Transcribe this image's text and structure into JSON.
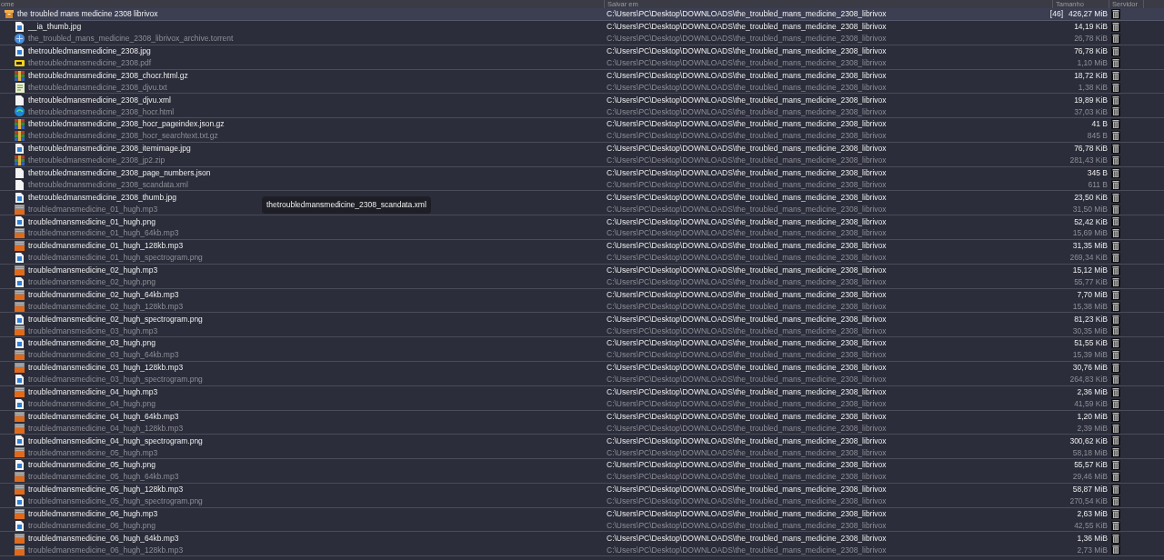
{
  "columns": [
    "ome",
    "Salvar em",
    "Tamanho",
    "Servidor"
  ],
  "group": {
    "name": "the troubled mans medicine 2308 librivox",
    "path": "C:\\Users\\PC\\Desktop\\DOWNLOADS\\the_troubled_mans_medicine_2308_librivox",
    "count": "[46]",
    "size": "426,27 MiB"
  },
  "files": [
    {
      "kind": "image",
      "name": "__ia_thumb.jpg",
      "path": "C:\\Users\\PC\\Desktop\\DOWNLOADS\\the_troubled_mans_medicine_2308_librivox",
      "size": "14,19 KiB"
    },
    {
      "kind": "torrent",
      "name": "the_troubled_mans_medicine_2308_librivox_archive.torrent",
      "path": "C:\\Users\\PC\\Desktop\\DOWNLOADS\\the_troubled_mans_medicine_2308_librivox",
      "size": "26,78 KiB"
    },
    {
      "kind": "image",
      "name": "thetroubledmansmedicine_2308.jpg",
      "path": "C:\\Users\\PC\\Desktop\\DOWNLOADS\\the_troubled_mans_medicine_2308_librivox",
      "size": "76,78 KiB"
    },
    {
      "kind": "pdf",
      "name": "thetroubledmansmedicine_2308.pdf",
      "path": "C:\\Users\\PC\\Desktop\\DOWNLOADS\\the_troubled_mans_medicine_2308_librivox",
      "size": "1,10 MiB"
    },
    {
      "kind": "archive",
      "name": "thetroubledmansmedicine_2308_chocr.html.gz",
      "path": "C:\\Users\\PC\\Desktop\\DOWNLOADS\\the_troubled_mans_medicine_2308_librivox",
      "size": "18,72 KiB"
    },
    {
      "kind": "text",
      "name": "thetroubledmansmedicine_2308_djvu.txt",
      "path": "C:\\Users\\PC\\Desktop\\DOWNLOADS\\the_troubled_mans_medicine_2308_librivox",
      "size": "1,38 KiB"
    },
    {
      "kind": "file",
      "name": "thetroubledmansmedicine_2308_djvu.xml",
      "path": "C:\\Users\\PC\\Desktop\\DOWNLOADS\\the_troubled_mans_medicine_2308_librivox",
      "size": "19,89 KiB"
    },
    {
      "kind": "web",
      "name": "thetroubledmansmedicine_2308_hocr.html",
      "path": "C:\\Users\\PC\\Desktop\\DOWNLOADS\\the_troubled_mans_medicine_2308_librivox",
      "size": "37,03 KiB"
    },
    {
      "kind": "archive",
      "name": "thetroubledmansmedicine_2308_hocr_pageindex.json.gz",
      "path": "C:\\Users\\PC\\Desktop\\DOWNLOADS\\the_troubled_mans_medicine_2308_librivox",
      "size": "41 B"
    },
    {
      "kind": "archive",
      "name": "thetroubledmansmedicine_2308_hocr_searchtext.txt.gz",
      "path": "C:\\Users\\PC\\Desktop\\DOWNLOADS\\the_troubled_mans_medicine_2308_librivox",
      "size": "845 B"
    },
    {
      "kind": "image",
      "name": "thetroubledmansmedicine_2308_itemimage.jpg",
      "path": "C:\\Users\\PC\\Desktop\\DOWNLOADS\\the_troubled_mans_medicine_2308_librivox",
      "size": "76,78 KiB"
    },
    {
      "kind": "archive",
      "name": "thetroubledmansmedicine_2308_jp2.zip",
      "path": "C:\\Users\\PC\\Desktop\\DOWNLOADS\\the_troubled_mans_medicine_2308_librivox",
      "size": "281,43 KiB"
    },
    {
      "kind": "file",
      "name": "thetroubledmansmedicine_2308_page_numbers.json",
      "path": "C:\\Users\\PC\\Desktop\\DOWNLOADS\\the_troubled_mans_medicine_2308_librivox",
      "size": "345 B"
    },
    {
      "kind": "file",
      "name": "thetroubledmansmedicine_2308_scandata.xml",
      "path": "C:\\Users\\PC\\Desktop\\DOWNLOADS\\the_troubled_mans_medicine_2308_librivox",
      "size": "611 B"
    },
    {
      "kind": "image",
      "name": "thetroubledmansmedicine_2308_thumb.jpg",
      "path": "C:\\Users\\PC\\Desktop\\DOWNLOADS\\the_troubled_mans_medicine_2308_librivox",
      "size": "23,50 KiB"
    },
    {
      "kind": "audio",
      "name": "troubledmansmedicine_01_hugh.mp3",
      "path": "C:\\Users\\PC\\Desktop\\DOWNLOADS\\the_troubled_mans_medicine_2308_librivox",
      "size": "31,50 MiB"
    },
    {
      "kind": "image",
      "name": "troubledmansmedicine_01_hugh.png",
      "path": "C:\\Users\\PC\\Desktop\\DOWNLOADS\\the_troubled_mans_medicine_2308_librivox",
      "size": "52,42 KiB"
    },
    {
      "kind": "audio",
      "name": "troubledmansmedicine_01_hugh_64kb.mp3",
      "path": "C:\\Users\\PC\\Desktop\\DOWNLOADS\\the_troubled_mans_medicine_2308_librivox",
      "size": "15,69 MiB"
    },
    {
      "kind": "audio",
      "name": "troubledmansmedicine_01_hugh_128kb.mp3",
      "path": "C:\\Users\\PC\\Desktop\\DOWNLOADS\\the_troubled_mans_medicine_2308_librivox",
      "size": "31,35 MiB"
    },
    {
      "kind": "image",
      "name": "troubledmansmedicine_01_hugh_spectrogram.png",
      "path": "C:\\Users\\PC\\Desktop\\DOWNLOADS\\the_troubled_mans_medicine_2308_librivox",
      "size": "269,34 KiB"
    },
    {
      "kind": "audio",
      "name": "troubledmansmedicine_02_hugh.mp3",
      "path": "C:\\Users\\PC\\Desktop\\DOWNLOADS\\the_troubled_mans_medicine_2308_librivox",
      "size": "15,12 MiB"
    },
    {
      "kind": "image",
      "name": "troubledmansmedicine_02_hugh.png",
      "path": "C:\\Users\\PC\\Desktop\\DOWNLOADS\\the_troubled_mans_medicine_2308_librivox",
      "size": "55,77 KiB"
    },
    {
      "kind": "audio",
      "name": "troubledmansmedicine_02_hugh_64kb.mp3",
      "path": "C:\\Users\\PC\\Desktop\\DOWNLOADS\\the_troubled_mans_medicine_2308_librivox",
      "size": "7,70 MiB"
    },
    {
      "kind": "audio",
      "name": "troubledmansmedicine_02_hugh_128kb.mp3",
      "path": "C:\\Users\\PC\\Desktop\\DOWNLOADS\\the_troubled_mans_medicine_2308_librivox",
      "size": "15,38 MiB"
    },
    {
      "kind": "image",
      "name": "troubledmansmedicine_02_hugh_spectrogram.png",
      "path": "C:\\Users\\PC\\Desktop\\DOWNLOADS\\the_troubled_mans_medicine_2308_librivox",
      "size": "81,23 KiB"
    },
    {
      "kind": "audio",
      "name": "troubledmansmedicine_03_hugh.mp3",
      "path": "C:\\Users\\PC\\Desktop\\DOWNLOADS\\the_troubled_mans_medicine_2308_librivox",
      "size": "30,35 MiB"
    },
    {
      "kind": "image",
      "name": "troubledmansmedicine_03_hugh.png",
      "path": "C:\\Users\\PC\\Desktop\\DOWNLOADS\\the_troubled_mans_medicine_2308_librivox",
      "size": "51,55 KiB"
    },
    {
      "kind": "audio",
      "name": "troubledmansmedicine_03_hugh_64kb.mp3",
      "path": "C:\\Users\\PC\\Desktop\\DOWNLOADS\\the_troubled_mans_medicine_2308_librivox",
      "size": "15,39 MiB"
    },
    {
      "kind": "audio",
      "name": "troubledmansmedicine_03_hugh_128kb.mp3",
      "path": "C:\\Users\\PC\\Desktop\\DOWNLOADS\\the_troubled_mans_medicine_2308_librivox",
      "size": "30,76 MiB"
    },
    {
      "kind": "image",
      "name": "troubledmansmedicine_03_hugh_spectrogram.png",
      "path": "C:\\Users\\PC\\Desktop\\DOWNLOADS\\the_troubled_mans_medicine_2308_librivox",
      "size": "264,83 KiB"
    },
    {
      "kind": "audio",
      "name": "troubledmansmedicine_04_hugh.mp3",
      "path": "C:\\Users\\PC\\Desktop\\DOWNLOADS\\the_troubled_mans_medicine_2308_librivox",
      "size": "2,36 MiB"
    },
    {
      "kind": "image",
      "name": "troubledmansmedicine_04_hugh.png",
      "path": "C:\\Users\\PC\\Desktop\\DOWNLOADS\\the_troubled_mans_medicine_2308_librivox",
      "size": "41,59 KiB"
    },
    {
      "kind": "audio",
      "name": "troubledmansmedicine_04_hugh_64kb.mp3",
      "path": "C:\\Users\\PC\\Desktop\\DOWNLOADS\\the_troubled_mans_medicine_2308_librivox",
      "size": "1,20 MiB"
    },
    {
      "kind": "audio",
      "name": "troubledmansmedicine_04_hugh_128kb.mp3",
      "path": "C:\\Users\\PC\\Desktop\\DOWNLOADS\\the_troubled_mans_medicine_2308_librivox",
      "size": "2,39 MiB"
    },
    {
      "kind": "image",
      "name": "troubledmansmedicine_04_hugh_spectrogram.png",
      "path": "C:\\Users\\PC\\Desktop\\DOWNLOADS\\the_troubled_mans_medicine_2308_librivox",
      "size": "300,62 KiB"
    },
    {
      "kind": "audio",
      "name": "troubledmansmedicine_05_hugh.mp3",
      "path": "C:\\Users\\PC\\Desktop\\DOWNLOADS\\the_troubled_mans_medicine_2308_librivox",
      "size": "58,18 MiB"
    },
    {
      "kind": "image",
      "name": "troubledmansmedicine_05_hugh.png",
      "path": "C:\\Users\\PC\\Desktop\\DOWNLOADS\\the_troubled_mans_medicine_2308_librivox",
      "size": "55,57 KiB"
    },
    {
      "kind": "audio",
      "name": "troubledmansmedicine_05_hugh_64kb.mp3",
      "path": "C:\\Users\\PC\\Desktop\\DOWNLOADS\\the_troubled_mans_medicine_2308_librivox",
      "size": "29,46 MiB"
    },
    {
      "kind": "audio",
      "name": "troubledmansmedicine_05_hugh_128kb.mp3",
      "path": "C:\\Users\\PC\\Desktop\\DOWNLOADS\\the_troubled_mans_medicine_2308_librivox",
      "size": "58,87 MiB"
    },
    {
      "kind": "image",
      "name": "troubledmansmedicine_05_hugh_spectrogram.png",
      "path": "C:\\Users\\PC\\Desktop\\DOWNLOADS\\the_troubled_mans_medicine_2308_librivox",
      "size": "270,54 KiB"
    },
    {
      "kind": "audio",
      "name": "troubledmansmedicine_06_hugh.mp3",
      "path": "C:\\Users\\PC\\Desktop\\DOWNLOADS\\the_troubled_mans_medicine_2308_librivox",
      "size": "2,63 MiB"
    },
    {
      "kind": "image",
      "name": "troubledmansmedicine_06_hugh.png",
      "path": "C:\\Users\\PC\\Desktop\\DOWNLOADS\\the_troubled_mans_medicine_2308_librivox",
      "size": "42,55 KiB"
    },
    {
      "kind": "audio",
      "name": "troubledmansmedicine_06_hugh_64kb.mp3",
      "path": "C:\\Users\\PC\\Desktop\\DOWNLOADS\\the_troubled_mans_medicine_2308_librivox",
      "size": "1,36 MiB"
    },
    {
      "kind": "audio",
      "name": "troubledmansmedicine_06_hugh_128kb.mp3",
      "path": "C:\\Users\\PC\\Desktop\\DOWNLOADS\\the_troubled_mans_medicine_2308_librivox",
      "size": "2,73 MiB"
    }
  ],
  "tooltip": "thetroubledmansmedicine_2308_scandata.xml"
}
